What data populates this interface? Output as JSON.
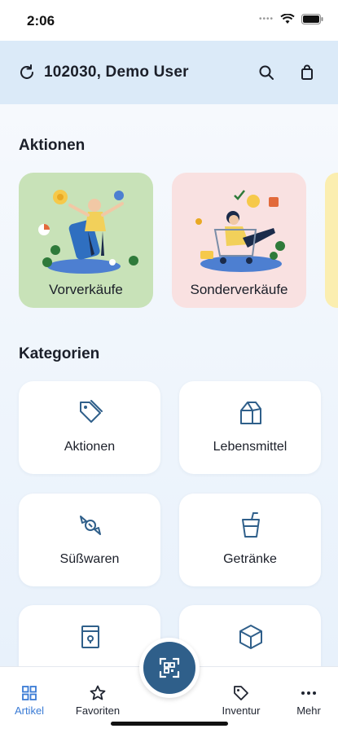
{
  "status_bar": {
    "time": "2:06"
  },
  "header": {
    "user_label": "102030, Demo User"
  },
  "aktionen": {
    "title": "Aktionen",
    "cards": [
      {
        "label": "Vorverkäufe",
        "color": "#c8e2b8"
      },
      {
        "label": "Sonderverkäufe",
        "color": "#f9e1e1"
      }
    ]
  },
  "kategorien": {
    "title": "Kategorien",
    "items": [
      {
        "label": "Aktionen",
        "icon": "tag-icon"
      },
      {
        "label": "Lebensmittel",
        "icon": "milk-carton-icon"
      },
      {
        "label": "Süßwaren",
        "icon": "candy-icon"
      },
      {
        "label": "Getränke",
        "icon": "drink-icon"
      },
      {
        "label": "",
        "icon": "notes-icon"
      },
      {
        "label": "",
        "icon": "box-icon"
      }
    ]
  },
  "nav": {
    "items": [
      {
        "label": "Artikel",
        "icon": "grid-icon",
        "active": true
      },
      {
        "label": "Favoriten",
        "icon": "star-icon"
      },
      {
        "label": "Inventur",
        "icon": "tag-icon"
      },
      {
        "label": "Mehr",
        "icon": "more-icon"
      }
    ],
    "accent": "#3a7bd5",
    "fab_color": "#2f5f8a"
  }
}
